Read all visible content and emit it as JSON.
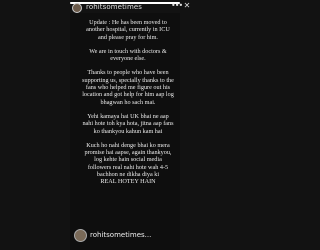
{
  "header": {
    "username": "rohitsometimes",
    "story_progress": 1.0
  },
  "note": {
    "paragraphs": [
      "Update : He has been moved to another hospital, currently in ICU and please pray for him.",
      "We are in touch with doctors & everyone else.",
      "Thanks to people who have been supporting us, specially thanks to the fans who helped me figure out his location and got help for him aap log bhagwan ho sach mai.",
      "Yehi kamaya hai UK bhai ne aap nahi hote toh kya hota, jitna aap fans ko thankyou kahun kam hai",
      "Kuch ho nahi denge bhai ko mera promise hai aapse, again thankyou, log kehte hain social media followers real nahi hote wah 4-5 bachhon ne dikha diya ki",
      "REAL HOTEY HAIN"
    ]
  },
  "footer": {
    "username": "rohitsometimes..."
  },
  "icons": {
    "more": "more-horizontal-icon",
    "close": "close-icon"
  }
}
